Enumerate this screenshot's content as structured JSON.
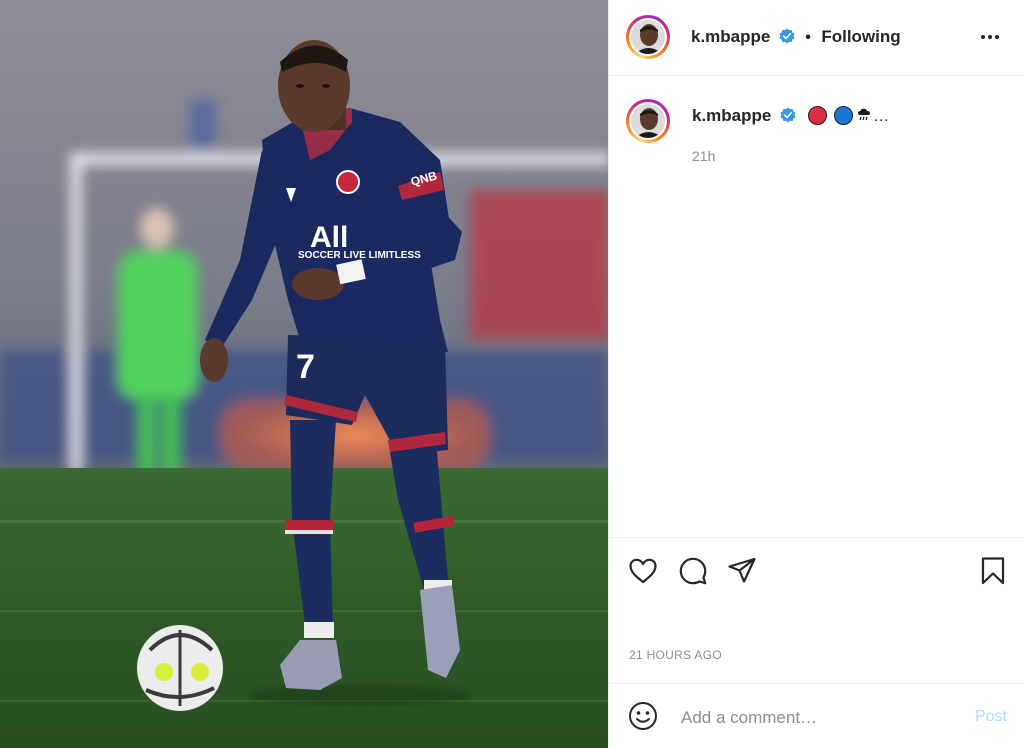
{
  "post": {
    "username": "k.mbappe",
    "separator": "•",
    "follow_status": "Following",
    "caption_emoji_tail": "…",
    "caption_time": "21h",
    "posted_time": "21 HOURS AGO",
    "comment_placeholder": "Add a comment…",
    "post_label": "Post"
  },
  "colors": {
    "accent": "#0095f6",
    "verified": "#3897f0",
    "post_disabled": "#b2dffc",
    "emoji_red": "#dd2e44",
    "emoji_blue": "#1976d2",
    "jersey": "#1a2a5a"
  },
  "icons": [
    "verified-badge-icon",
    "more-options-icon",
    "heart-icon",
    "comment-icon",
    "share-icon",
    "bookmark-icon",
    "smiley-icon",
    "cloud-rain-emoji"
  ]
}
